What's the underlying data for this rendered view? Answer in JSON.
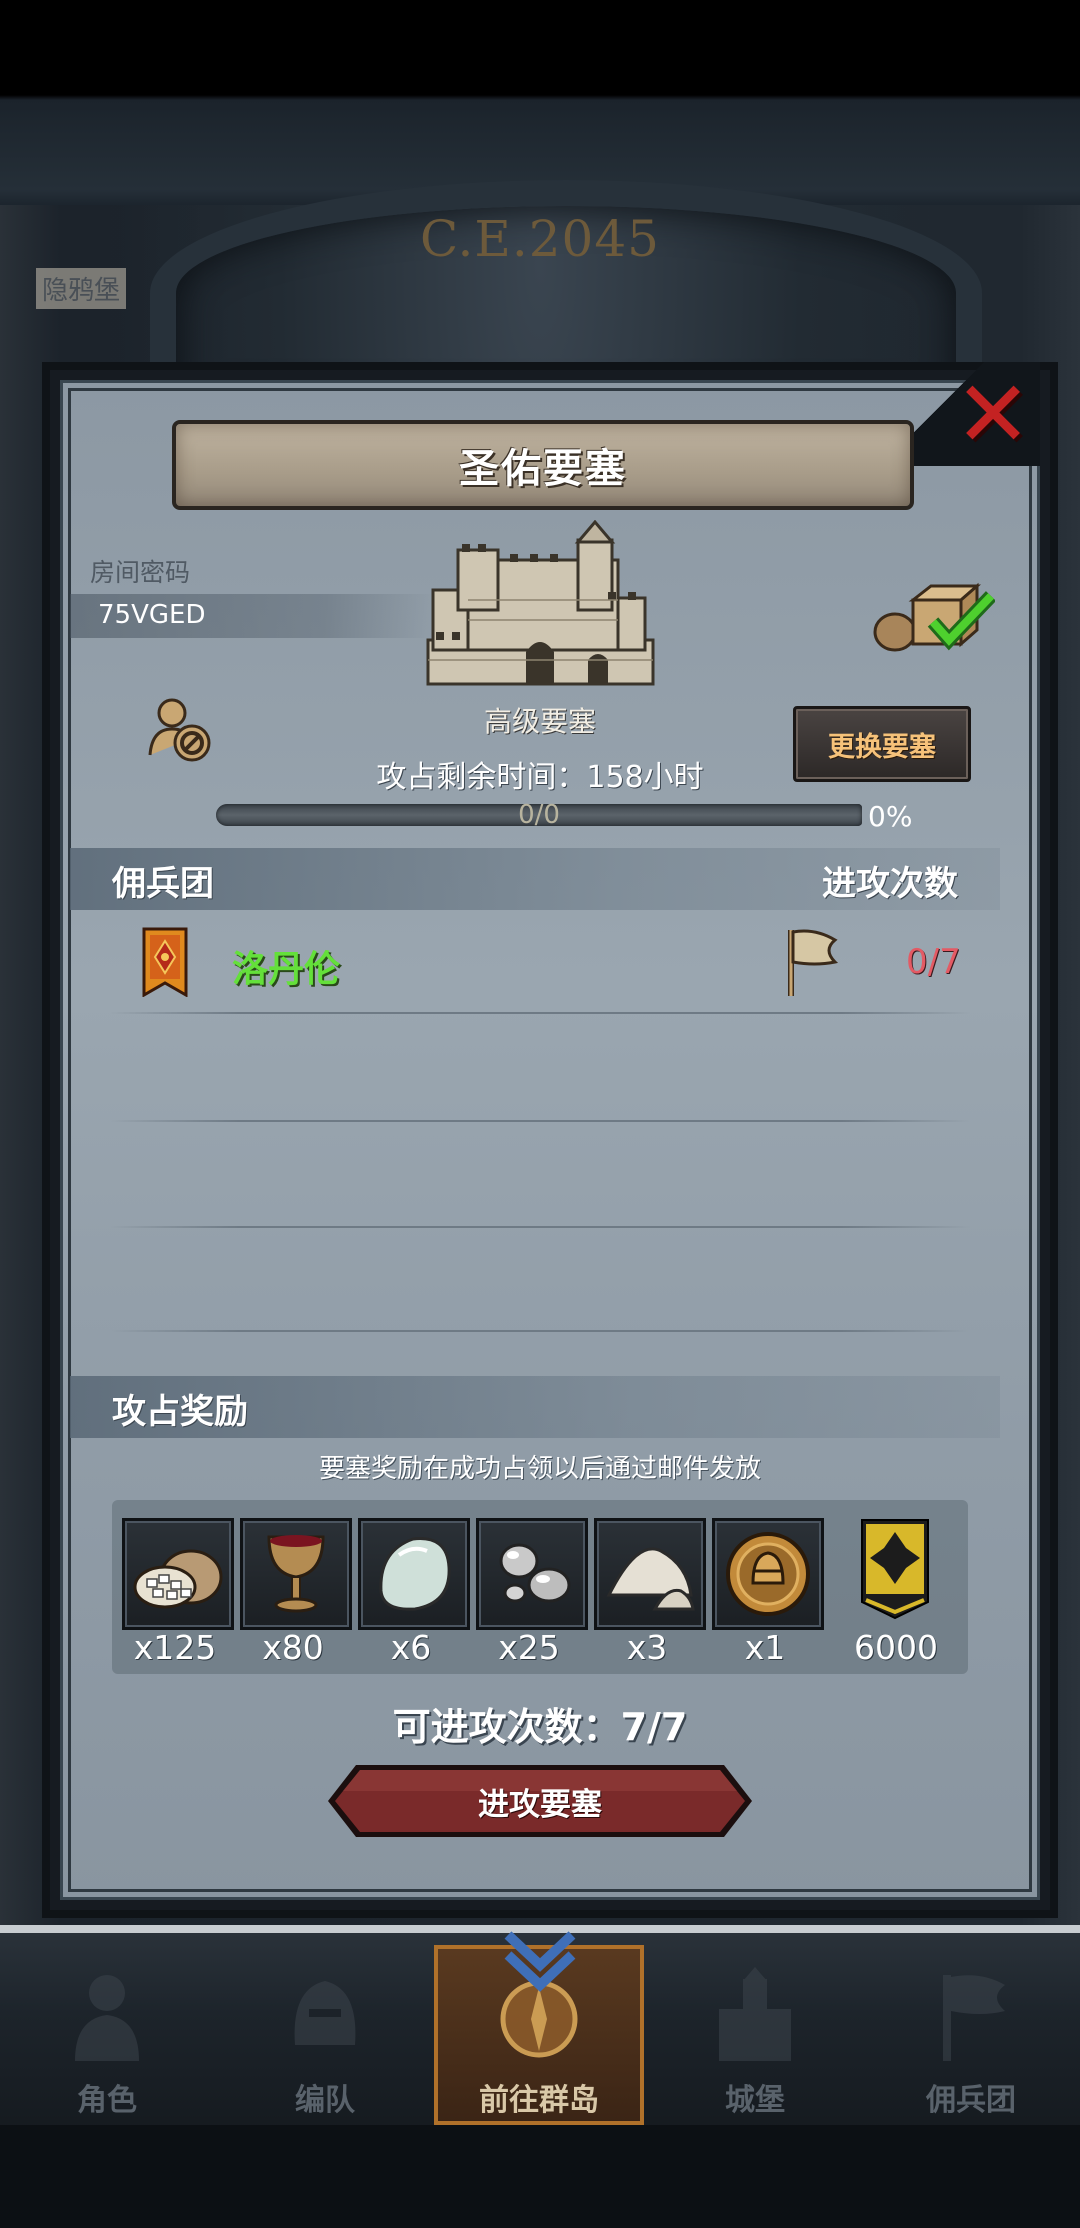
{
  "background": {
    "year_text": "C.E.2045",
    "town_label": "隐鸦堡"
  },
  "dialog": {
    "title": "圣佑要塞",
    "room_code_label": "房间密码",
    "room_code_value": "75VGED",
    "fortress_type": "高级要塞",
    "change_button": "更换要塞",
    "time_remaining": "攻占剩余时间：158小时",
    "progress_text": "0/0",
    "progress_percent": "0%",
    "progress_value": 0,
    "mercenary_header": "佣兵团",
    "attack_count_header": "进攻次数",
    "mercenary_rows": [
      {
        "name": "洛丹伦",
        "count": "0/7"
      }
    ],
    "reward_header": "攻占奖励",
    "reward_note": "要塞奖励在成功占领以后通过邮件发放",
    "rewards": [
      {
        "icon": "coin-sack-icon",
        "qty": "x125"
      },
      {
        "icon": "goblet-icon",
        "qty": "x80"
      },
      {
        "icon": "gem-stone-icon",
        "qty": "x6"
      },
      {
        "icon": "silver-ore-icon",
        "qty": "x25"
      },
      {
        "icon": "flour-pile-icon",
        "qty": "x3"
      },
      {
        "icon": "knight-medal-icon",
        "qty": "x1"
      },
      {
        "icon": "guild-banner-icon",
        "qty": "6000"
      }
    ],
    "attacks_remaining": "可进攻次数：7/7",
    "attack_button": "进攻要塞"
  },
  "nav": [
    {
      "label": "角色",
      "icon": "knight-icon",
      "active": false
    },
    {
      "label": "编队",
      "icon": "helmet-icon",
      "active": false
    },
    {
      "label": "前往群岛",
      "icon": "compass-icon",
      "active": true
    },
    {
      "label": "城堡",
      "icon": "castle-icon",
      "active": false
    },
    {
      "label": "佣兵团",
      "icon": "mercenary-icon",
      "active": false
    }
  ],
  "colors": {
    "merc_name": "#64e03a",
    "merc_count": "#e35a64",
    "change_button_text": "#f6c27a",
    "close_x": "#c42222",
    "attack_button": "#7a2a2a"
  }
}
